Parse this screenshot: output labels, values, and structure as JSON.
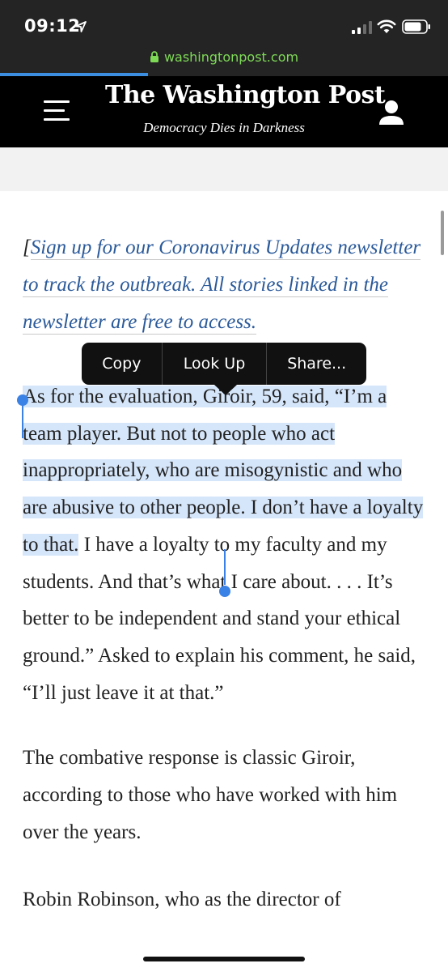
{
  "status_bar": {
    "time": "09:12",
    "icons": [
      "location-arrow-icon",
      "cellular-signal-icon",
      "wifi-icon",
      "battery-icon"
    ]
  },
  "browser": {
    "url": "washingtonpost.com",
    "load_progress": 0.33,
    "colors": {
      "url_text": "#7ed957",
      "progress": "#3b8ee0"
    }
  },
  "masthead": {
    "logo": "The Washington Post",
    "tagline": "Democracy Dies in Darkness",
    "icons": [
      "menu-icon",
      "account-icon"
    ]
  },
  "article": {
    "promo": {
      "open_bracket": "[",
      "link_text": "Sign up for our Coronavirus Updates newsletter to track the outbreak. All stories linked in the newsletter are free to access."
    },
    "para1": {
      "selected": "As for the evaluation, Giroir, 59, said, “I’m a team player. But not to people who act inappropriately, who are misogynistic and who are abusive to other people. I don’t have a loyalty to that.",
      "rest": " I have a loyalty to my faculty and my students. And that’s what I care about. . . . It’s better to be independent and stand your ethical ground.” Asked to explain his comment, he said, “I’ll just leave it at that.”"
    },
    "para2": "The combative response is classic Giroir, according to those who have worked with him over the years.",
    "para3": "Robin Robinson, who as the director of",
    "colors": {
      "link": "#2b5a9a",
      "selection": "#d6e6fa",
      "handle": "#3b82e6"
    }
  },
  "context_menu": {
    "items": [
      "Copy",
      "Look Up",
      "Share..."
    ]
  }
}
